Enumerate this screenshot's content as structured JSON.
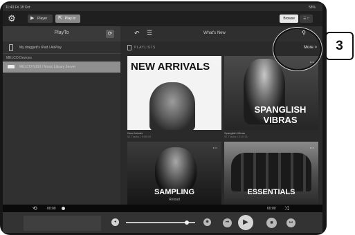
{
  "status_bar": {
    "time": "11:43  Fri 18 Oct",
    "battery": "58%"
  },
  "toolbar": {
    "player_label": "Player",
    "playto_label": "Play to",
    "browse_label": "Browse",
    "other_label": "☰ □"
  },
  "play_to_panel": {
    "title": "PlayTo",
    "device_label": "My draggett's iPad / AirPlay",
    "section_label": "MELCO Devices",
    "selected_device": "MELCO N100 / Music Library Server"
  },
  "browse_panel": {
    "title": "What's New",
    "section_label": "PLAYLISTS",
    "more_label": "More >",
    "tiles": [
      {
        "art_text": "NEW ARRIVALS",
        "name": "New Arrivals",
        "subtitle": "51 Tracks | 3:05:53"
      },
      {
        "art_text": "SPANGLISH VIBRAS",
        "name": "Spanglish Vibras",
        "subtitle": "57 Tracks | 3:10:31"
      },
      {
        "art_text": "SAMPLING",
        "art_sub": "Reload"
      },
      {
        "art_text": "ESSENTIALS"
      }
    ]
  },
  "progress": {
    "elapsed": "00:00",
    "remaining": "00:00"
  },
  "volume": {
    "level": 0.88
  },
  "callout": {
    "number": "3"
  },
  "colors": {
    "bezel": "#161616",
    "screen_bg": "#2c2c2c",
    "selected_row": "#8f8f8f",
    "accent": "#e8e8e8"
  }
}
